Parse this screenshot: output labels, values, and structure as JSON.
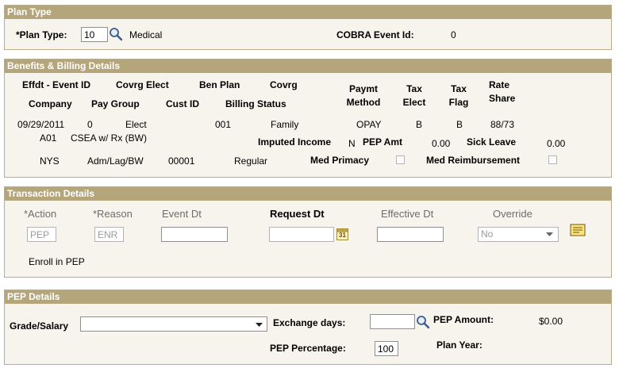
{
  "plan_type": {
    "header": "Plan Type",
    "plan_type_label": "*Plan Type:",
    "plan_type_value": "10",
    "plan_type_desc": "Medical",
    "cobra_label": "COBRA Event Id:",
    "cobra_value": "0"
  },
  "benefits": {
    "header": "Benefits & Billing Details",
    "headers": {
      "effdt": "Effdt - Event ID",
      "covrg_elect": "Covrg Elect",
      "ben_plan": "Ben Plan",
      "covrg": "Covrg",
      "paymt_1": "Paymt",
      "paymt_2": "Method",
      "tax_elect_1": "Tax",
      "tax_elect_2": "Elect",
      "tax_flag_1": "Tax",
      "tax_flag_2": "Flag",
      "rate_1": "Rate",
      "rate_2": "Share",
      "company": "Company",
      "pay_group": "Pay Group",
      "cust_id": "Cust ID",
      "billing_status": "Billing Status"
    },
    "row1": {
      "effdt": "09/29/2011",
      "event_id": "0",
      "covrg_elect": "Elect",
      "ben_plan": "001",
      "covrg": "Family",
      "paymt": "OPAY",
      "tax_elect": "B",
      "tax_flag": "B",
      "rate_share": "88/73"
    },
    "row2": {
      "company": "A01",
      "plan_desc": "CSEA w/ Rx (BW)",
      "imputed_label": "Imputed Income",
      "imputed_value": "N",
      "pep_amt_label": "PEP Amt",
      "pep_amt_value": "0.00",
      "sick_label": "Sick Leave",
      "sick_value": "0.00"
    },
    "row3": {
      "company": "NYS",
      "pay_group": "Adm/Lag/BW",
      "cust_id": "00001",
      "billing_status": "Regular",
      "med_primacy_label": "Med Primacy",
      "med_reimb_label": "Med Reimbursement"
    }
  },
  "transaction": {
    "header": "Transaction Details",
    "labels": {
      "action": "*Action",
      "reason": "*Reason",
      "event_dt": "Event Dt",
      "request_dt": "Request Dt",
      "effective_dt": "Effective Dt",
      "override": "Override"
    },
    "values": {
      "action": "PEP",
      "reason": "ENR",
      "event_dt": "",
      "request_dt": "",
      "effective_dt": "",
      "override": "No"
    },
    "calendar_icon_text": "31",
    "description": "Enroll in PEP"
  },
  "pep": {
    "header": "PEP Details",
    "grade_label": "Grade/Salary",
    "grade_value": "",
    "exchange_label": "Exchange days:",
    "exchange_value": "",
    "pep_amount_label": "PEP Amount:",
    "pep_amount_value": "$0.00",
    "pep_pct_label": "PEP Percentage:",
    "pep_pct_value": "100",
    "plan_year_label": "Plan Year:",
    "plan_year_value": ""
  },
  "icons": {
    "lookup": "search-icon",
    "calendar": "calendar-icon",
    "note": "note-icon",
    "dropdown": "chevron-down-icon"
  },
  "colors": {
    "panel_header": "#b5a57a",
    "panel_bg": "#f6f4ec",
    "panel_border": "#b8ae8e"
  }
}
